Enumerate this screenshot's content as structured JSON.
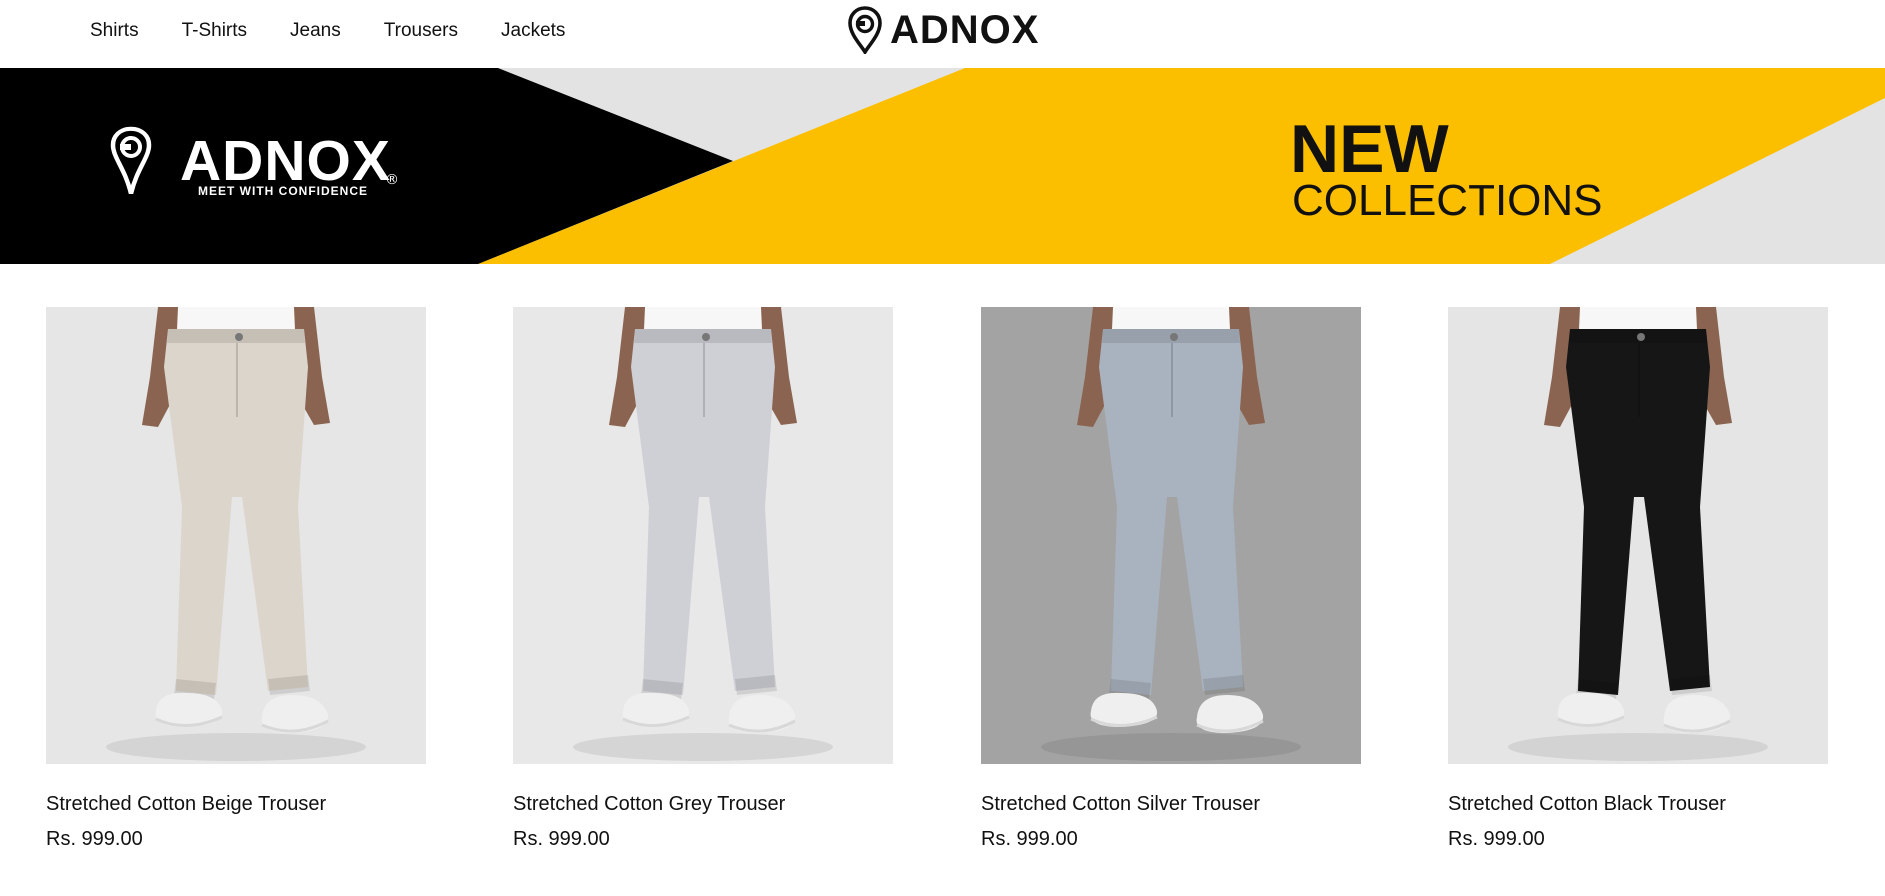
{
  "nav": {
    "items": [
      {
        "label": "Shirts"
      },
      {
        "label": "T-Shirts"
      },
      {
        "label": "Jeans"
      },
      {
        "label": "Trousers"
      },
      {
        "label": "Jackets"
      }
    ]
  },
  "brand": {
    "name": "ADNOX"
  },
  "banner": {
    "logo_text": "ADNOX",
    "tagline": "MEET WITH CONFIDENCE",
    "headline": "NEW",
    "subheadline": "COLLECTIONS",
    "colors": {
      "black": "#000000",
      "yellow": "#FCBF00",
      "grey": "#E3E3E3"
    }
  },
  "products": [
    {
      "title": "Stretched Cotton Beige Trouser",
      "price": "Rs. 999.00",
      "trouser_color": "#dcd5cb",
      "bg_color": "#e6e6e6"
    },
    {
      "title": "Stretched Cotton Grey Trouser",
      "price": "Rs. 999.00",
      "trouser_color": "#cfcfd6",
      "bg_color": "#e8e8e8"
    },
    {
      "title": "Stretched Cotton Silver Trouser",
      "price": "Rs. 999.00",
      "trouser_color": "#a9b3bf",
      "bg_color": "#a3a3a3"
    },
    {
      "title": "Stretched Cotton Black Trouser",
      "price": "Rs. 999.00",
      "trouser_color": "#161616",
      "bg_color": "#e5e5e5"
    }
  ]
}
